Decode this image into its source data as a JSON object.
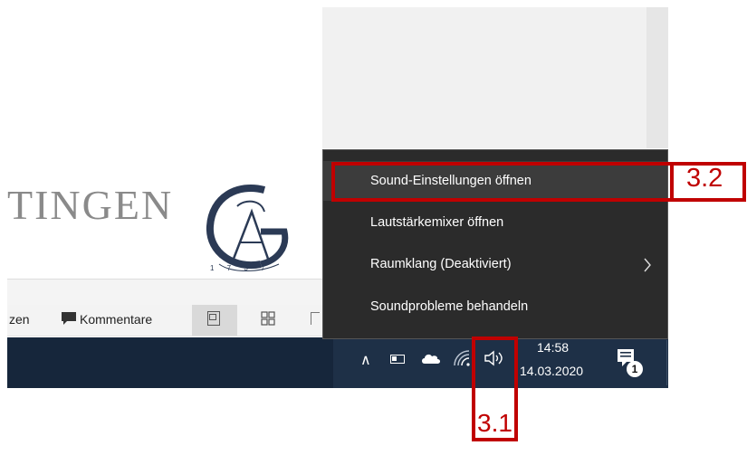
{
  "logo": {
    "text": "TINGEN",
    "sub": "1 7 3 7"
  },
  "ribbon": {
    "partial_label": "zen",
    "comments_label": "Kommentare"
  },
  "menu": {
    "items": [
      {
        "label": "Sound-Einstellungen öffnen"
      },
      {
        "label": "Lautstärkemixer öffnen"
      },
      {
        "label": "Raumklang (Deaktiviert)"
      },
      {
        "label": "Soundprobleme behandeln"
      }
    ]
  },
  "taskbar": {
    "time": "14:58",
    "date": "14.03.2020",
    "notification_count": "1"
  },
  "annotations": {
    "step_a": "3.2",
    "step_b": "3.1"
  },
  "colors": {
    "annotation": "#c00000",
    "taskbar": "#1e3047",
    "menu_bg": "#2b2b2b",
    "menu_highlight": "#3c3c3c"
  },
  "icons": [
    "comment-icon",
    "single-page-view-icon",
    "grid-view-icon",
    "show-hidden-icons-icon",
    "battery-icon",
    "onedrive-cloud-icon",
    "wifi-icon",
    "speaker-volume-icon",
    "notification-center-icon",
    "chevron-right-icon"
  ]
}
